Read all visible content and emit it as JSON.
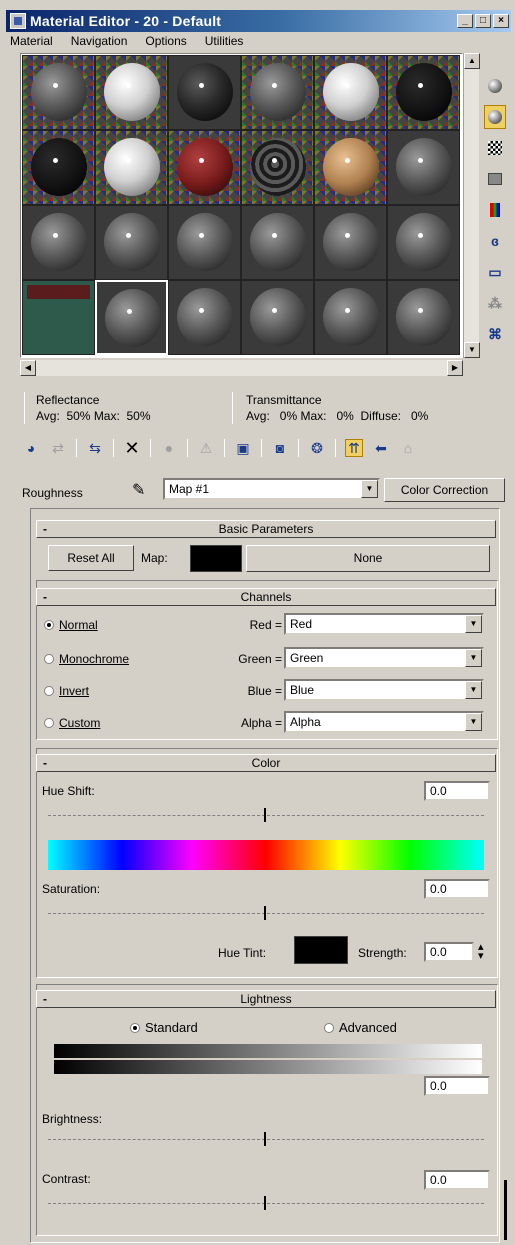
{
  "window": {
    "title": "Material Editor - 20 - Default",
    "buttons": [
      "_",
      "□",
      "×"
    ]
  },
  "menu": [
    "Material",
    "Navigation",
    "Options",
    "Utilities"
  ],
  "sample_slots": [
    "checker-gray",
    "checker-white",
    "dark",
    "checker-gray-dot",
    "checker-white-dot",
    "checker-dark",
    "checker-black",
    "checker-white",
    "checker-red",
    "checker-swirl",
    "checker-tan",
    "gray",
    "gray",
    "gray",
    "gray",
    "gray",
    "gray",
    "gray",
    "box-green",
    "gray-selected",
    "gray",
    "gray",
    "gray",
    "gray"
  ],
  "right_toolbar_icons": [
    "sample-type-icon",
    "backlight-icon",
    "background-checker-icon",
    "sample-uv-tiling-icon",
    "video-color-check-icon",
    "make-preview-icon",
    "options-icon",
    "select-by-material-icon",
    "material-map-navigator-icon"
  ],
  "reflectance": {
    "label": "Reflectance",
    "values": "Avg:  50% Max:  50%"
  },
  "transmittance": {
    "label": "Transmittance",
    "values": "Avg:   0% Max:   0%  Diffuse:   0%"
  },
  "roughness": {
    "label": "Roughness",
    "map_name": "Map #1",
    "color_correction_button": "Color Correction"
  },
  "basic_parameters": {
    "title": "Basic Parameters",
    "reset_all": "Reset All",
    "map_label": "Map:",
    "none_button": "None"
  },
  "channels": {
    "title": "Channels",
    "modes": [
      {
        "label": "Normal",
        "selected": true
      },
      {
        "label": "Monochrome",
        "selected": false
      },
      {
        "label": "Invert",
        "selected": false
      },
      {
        "label": "Custom",
        "selected": false
      }
    ],
    "fields": [
      {
        "label": "Red =",
        "value": "Red"
      },
      {
        "label": "Green =",
        "value": "Green"
      },
      {
        "label": "Blue =",
        "value": "Blue"
      },
      {
        "label": "Alpha =",
        "value": "Alpha"
      }
    ]
  },
  "color": {
    "title": "Color",
    "hue_shift_label": "Hue Shift:",
    "hue_shift_value": "0.0",
    "saturation_label": "Saturation:",
    "saturation_value": "0.0",
    "hue_tint_label": "Hue Tint:",
    "strength_label": "Strength:",
    "strength_value": "0.0"
  },
  "lightness": {
    "title": "Lightness",
    "standard_label": "Standard",
    "advanced_label": "Advanced",
    "brightness_label": "Brightness:",
    "brightness_value": "0.0",
    "contrast_label": "Contrast:",
    "contrast_value": "0.0"
  },
  "colors": {
    "titlebar": "#0a246a",
    "face": "#d4d0c8",
    "active_tool": "#f0d060"
  }
}
